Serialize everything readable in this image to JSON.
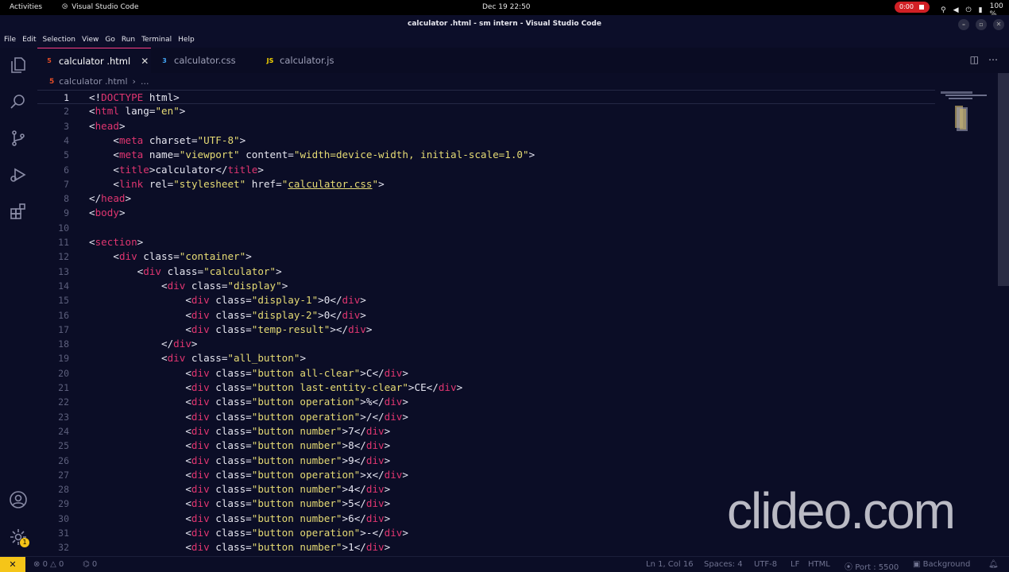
{
  "gnome": {
    "activities": "Activities",
    "app_name": "Visual Studio Code",
    "clock": "Dec 19  22:50",
    "recording": "0:00",
    "battery": "100 %"
  },
  "window": {
    "title": "calculator .html - sm intern - Visual Studio Code"
  },
  "menu": [
    "File",
    "Edit",
    "Selection",
    "View",
    "Go",
    "Run",
    "Terminal",
    "Help"
  ],
  "tabs": [
    {
      "label": "calculator .html",
      "icon": "html5-icon",
      "active": true
    },
    {
      "label": "calculator.css",
      "icon": "css3-icon",
      "active": false
    },
    {
      "label": "calculator.js",
      "icon": "js-icon",
      "active": false
    }
  ],
  "breadcrumb": {
    "file": "calculator .html",
    "more": "..."
  },
  "code_lines": [
    [
      [
        "pn",
        "<!"
      ],
      [
        "tg",
        "DOCTYPE"
      ],
      [
        "at",
        " html"
      ],
      [
        "pn",
        ">"
      ]
    ],
    [
      [
        "pn",
        "<"
      ],
      [
        "tg",
        "html"
      ],
      [
        "at",
        " lang"
      ],
      [
        "pn",
        "="
      ],
      [
        "st",
        "\"en\""
      ],
      [
        "pn",
        ">"
      ]
    ],
    [
      [
        "pn",
        "<"
      ],
      [
        "tg",
        "head"
      ],
      [
        "pn",
        ">"
      ]
    ],
    [
      [
        "tx",
        "    "
      ],
      [
        "pn",
        "<"
      ],
      [
        "tg",
        "meta"
      ],
      [
        "at",
        " charset"
      ],
      [
        "pn",
        "="
      ],
      [
        "st",
        "\"UTF-8\""
      ],
      [
        "pn",
        ">"
      ]
    ],
    [
      [
        "tx",
        "    "
      ],
      [
        "pn",
        "<"
      ],
      [
        "tg",
        "meta"
      ],
      [
        "at",
        " name"
      ],
      [
        "pn",
        "="
      ],
      [
        "st",
        "\"viewport\""
      ],
      [
        "at",
        " content"
      ],
      [
        "pn",
        "="
      ],
      [
        "st",
        "\"width=device-width, initial-scale=1.0\""
      ],
      [
        "pn",
        ">"
      ]
    ],
    [
      [
        "tx",
        "    "
      ],
      [
        "pn",
        "<"
      ],
      [
        "tg",
        "title"
      ],
      [
        "pn",
        ">"
      ],
      [
        "tx",
        "calculator"
      ],
      [
        "pn",
        "</"
      ],
      [
        "tg",
        "title"
      ],
      [
        "pn",
        ">"
      ]
    ],
    [
      [
        "tx",
        "    "
      ],
      [
        "pn",
        "<"
      ],
      [
        "tg",
        "link"
      ],
      [
        "at",
        " rel"
      ],
      [
        "pn",
        "="
      ],
      [
        "st",
        "\"stylesheet\""
      ],
      [
        "at",
        " href"
      ],
      [
        "pn",
        "="
      ],
      [
        "st",
        "\""
      ],
      [
        "lk",
        "calculator.css"
      ],
      [
        "st",
        "\""
      ],
      [
        "pn",
        ">"
      ]
    ],
    [
      [
        "pn",
        "</"
      ],
      [
        "tg",
        "head"
      ],
      [
        "pn",
        ">"
      ]
    ],
    [
      [
        "pn",
        "<"
      ],
      [
        "tg",
        "body"
      ],
      [
        "pn",
        ">"
      ]
    ],
    [],
    [
      [
        "pn",
        "<"
      ],
      [
        "tg",
        "section"
      ],
      [
        "pn",
        ">"
      ]
    ],
    [
      [
        "tx",
        "    "
      ],
      [
        "pn",
        "<"
      ],
      [
        "tg",
        "div"
      ],
      [
        "at",
        " class"
      ],
      [
        "pn",
        "="
      ],
      [
        "st",
        "\"container\""
      ],
      [
        "pn",
        ">"
      ]
    ],
    [
      [
        "tx",
        "        "
      ],
      [
        "pn",
        "<"
      ],
      [
        "tg",
        "div"
      ],
      [
        "at",
        " class"
      ],
      [
        "pn",
        "="
      ],
      [
        "st",
        "\"calculator\""
      ],
      [
        "pn",
        ">"
      ]
    ],
    [
      [
        "tx",
        "            "
      ],
      [
        "pn",
        "<"
      ],
      [
        "tg",
        "div"
      ],
      [
        "at",
        " class"
      ],
      [
        "pn",
        "="
      ],
      [
        "st",
        "\"display\""
      ],
      [
        "pn",
        ">"
      ]
    ],
    [
      [
        "tx",
        "                "
      ],
      [
        "pn",
        "<"
      ],
      [
        "tg",
        "div"
      ],
      [
        "at",
        " class"
      ],
      [
        "pn",
        "="
      ],
      [
        "st",
        "\"display-1\""
      ],
      [
        "pn",
        ">"
      ],
      [
        "tx",
        "0"
      ],
      [
        "pn",
        "</"
      ],
      [
        "tg",
        "div"
      ],
      [
        "pn",
        ">"
      ]
    ],
    [
      [
        "tx",
        "                "
      ],
      [
        "pn",
        "<"
      ],
      [
        "tg",
        "div"
      ],
      [
        "at",
        " class"
      ],
      [
        "pn",
        "="
      ],
      [
        "st",
        "\"display-2\""
      ],
      [
        "pn",
        ">"
      ],
      [
        "tx",
        "0"
      ],
      [
        "pn",
        "</"
      ],
      [
        "tg",
        "div"
      ],
      [
        "pn",
        ">"
      ]
    ],
    [
      [
        "tx",
        "                "
      ],
      [
        "pn",
        "<"
      ],
      [
        "tg",
        "div"
      ],
      [
        "at",
        " class"
      ],
      [
        "pn",
        "="
      ],
      [
        "st",
        "\"temp-result\""
      ],
      [
        "pn",
        "></"
      ],
      [
        "tg",
        "div"
      ],
      [
        "pn",
        ">"
      ]
    ],
    [
      [
        "tx",
        "            "
      ],
      [
        "pn",
        "</"
      ],
      [
        "tg",
        "div"
      ],
      [
        "pn",
        ">"
      ]
    ],
    [
      [
        "tx",
        "            "
      ],
      [
        "pn",
        "<"
      ],
      [
        "tg",
        "div"
      ],
      [
        "at",
        " class"
      ],
      [
        "pn",
        "="
      ],
      [
        "st",
        "\"all_button\""
      ],
      [
        "pn",
        ">"
      ]
    ],
    [
      [
        "tx",
        "                "
      ],
      [
        "pn",
        "<"
      ],
      [
        "tg",
        "div"
      ],
      [
        "at",
        " class"
      ],
      [
        "pn",
        "="
      ],
      [
        "st",
        "\"button all-clear\""
      ],
      [
        "pn",
        ">"
      ],
      [
        "tx",
        "C"
      ],
      [
        "pn",
        "</"
      ],
      [
        "tg",
        "div"
      ],
      [
        "pn",
        ">"
      ]
    ],
    [
      [
        "tx",
        "                "
      ],
      [
        "pn",
        "<"
      ],
      [
        "tg",
        "div"
      ],
      [
        "at",
        " class"
      ],
      [
        "pn",
        "="
      ],
      [
        "st",
        "\"button last-entity-clear\""
      ],
      [
        "pn",
        ">"
      ],
      [
        "tx",
        "CE"
      ],
      [
        "pn",
        "</"
      ],
      [
        "tg",
        "div"
      ],
      [
        "pn",
        ">"
      ]
    ],
    [
      [
        "tx",
        "                "
      ],
      [
        "pn",
        "<"
      ],
      [
        "tg",
        "div"
      ],
      [
        "at",
        " class"
      ],
      [
        "pn",
        "="
      ],
      [
        "st",
        "\"button operation\""
      ],
      [
        "pn",
        ">"
      ],
      [
        "tx",
        "%"
      ],
      [
        "pn",
        "</"
      ],
      [
        "tg",
        "div"
      ],
      [
        "pn",
        ">"
      ]
    ],
    [
      [
        "tx",
        "                "
      ],
      [
        "pn",
        "<"
      ],
      [
        "tg",
        "div"
      ],
      [
        "at",
        " class"
      ],
      [
        "pn",
        "="
      ],
      [
        "st",
        "\"button operation\""
      ],
      [
        "pn",
        ">"
      ],
      [
        "tx",
        "/"
      ],
      [
        "pn",
        "</"
      ],
      [
        "tg",
        "div"
      ],
      [
        "pn",
        ">"
      ]
    ],
    [
      [
        "tx",
        "                "
      ],
      [
        "pn",
        "<"
      ],
      [
        "tg",
        "div"
      ],
      [
        "at",
        " class"
      ],
      [
        "pn",
        "="
      ],
      [
        "st",
        "\"button number\""
      ],
      [
        "pn",
        ">"
      ],
      [
        "tx",
        "7"
      ],
      [
        "pn",
        "</"
      ],
      [
        "tg",
        "div"
      ],
      [
        "pn",
        ">"
      ]
    ],
    [
      [
        "tx",
        "                "
      ],
      [
        "pn",
        "<"
      ],
      [
        "tg",
        "div"
      ],
      [
        "at",
        " class"
      ],
      [
        "pn",
        "="
      ],
      [
        "st",
        "\"button number\""
      ],
      [
        "pn",
        ">"
      ],
      [
        "tx",
        "8"
      ],
      [
        "pn",
        "</"
      ],
      [
        "tg",
        "div"
      ],
      [
        "pn",
        ">"
      ]
    ],
    [
      [
        "tx",
        "                "
      ],
      [
        "pn",
        "<"
      ],
      [
        "tg",
        "div"
      ],
      [
        "at",
        " class"
      ],
      [
        "pn",
        "="
      ],
      [
        "st",
        "\"button number\""
      ],
      [
        "pn",
        ">"
      ],
      [
        "tx",
        "9"
      ],
      [
        "pn",
        "</"
      ],
      [
        "tg",
        "div"
      ],
      [
        "pn",
        ">"
      ]
    ],
    [
      [
        "tx",
        "                "
      ],
      [
        "pn",
        "<"
      ],
      [
        "tg",
        "div"
      ],
      [
        "at",
        " class"
      ],
      [
        "pn",
        "="
      ],
      [
        "st",
        "\"button operation\""
      ],
      [
        "pn",
        ">"
      ],
      [
        "tx",
        "x"
      ],
      [
        "pn",
        "</"
      ],
      [
        "tg",
        "div"
      ],
      [
        "pn",
        ">"
      ]
    ],
    [
      [
        "tx",
        "                "
      ],
      [
        "pn",
        "<"
      ],
      [
        "tg",
        "div"
      ],
      [
        "at",
        " class"
      ],
      [
        "pn",
        "="
      ],
      [
        "st",
        "\"button number\""
      ],
      [
        "pn",
        ">"
      ],
      [
        "tx",
        "4"
      ],
      [
        "pn",
        "</"
      ],
      [
        "tg",
        "div"
      ],
      [
        "pn",
        ">"
      ]
    ],
    [
      [
        "tx",
        "                "
      ],
      [
        "pn",
        "<"
      ],
      [
        "tg",
        "div"
      ],
      [
        "at",
        " class"
      ],
      [
        "pn",
        "="
      ],
      [
        "st",
        "\"button number\""
      ],
      [
        "pn",
        ">"
      ],
      [
        "tx",
        "5"
      ],
      [
        "pn",
        "</"
      ],
      [
        "tg",
        "div"
      ],
      [
        "pn",
        ">"
      ]
    ],
    [
      [
        "tx",
        "                "
      ],
      [
        "pn",
        "<"
      ],
      [
        "tg",
        "div"
      ],
      [
        "at",
        " class"
      ],
      [
        "pn",
        "="
      ],
      [
        "st",
        "\"button number\""
      ],
      [
        "pn",
        ">"
      ],
      [
        "tx",
        "6"
      ],
      [
        "pn",
        "</"
      ],
      [
        "tg",
        "div"
      ],
      [
        "pn",
        ">"
      ]
    ],
    [
      [
        "tx",
        "                "
      ],
      [
        "pn",
        "<"
      ],
      [
        "tg",
        "div"
      ],
      [
        "at",
        " class"
      ],
      [
        "pn",
        "="
      ],
      [
        "st",
        "\"button operation\""
      ],
      [
        "pn",
        ">"
      ],
      [
        "tx",
        "-"
      ],
      [
        "pn",
        "</"
      ],
      [
        "tg",
        "div"
      ],
      [
        "pn",
        ">"
      ]
    ],
    [
      [
        "tx",
        "                "
      ],
      [
        "pn",
        "<"
      ],
      [
        "tg",
        "div"
      ],
      [
        "at",
        " class"
      ],
      [
        "pn",
        "="
      ],
      [
        "st",
        "\"button number\""
      ],
      [
        "pn",
        ">"
      ],
      [
        "tx",
        "1"
      ],
      [
        "pn",
        "</"
      ],
      [
        "tg",
        "div"
      ],
      [
        "pn",
        ">"
      ]
    ]
  ],
  "current_line": 1,
  "watermark": "clideo.com",
  "status": {
    "errors": "0",
    "warnings": "0",
    "ports": "0",
    "position": "Ln 1, Col 16",
    "spaces": "Spaces: 4",
    "encoding": "UTF-8",
    "eol": "LF",
    "language": "HTML",
    "port": "Port : 5500",
    "background": "Background"
  },
  "colors": {
    "accent": "#ff3f86",
    "tag": "#e03570",
    "string": "#e6db74",
    "remote": "#f5c518"
  }
}
